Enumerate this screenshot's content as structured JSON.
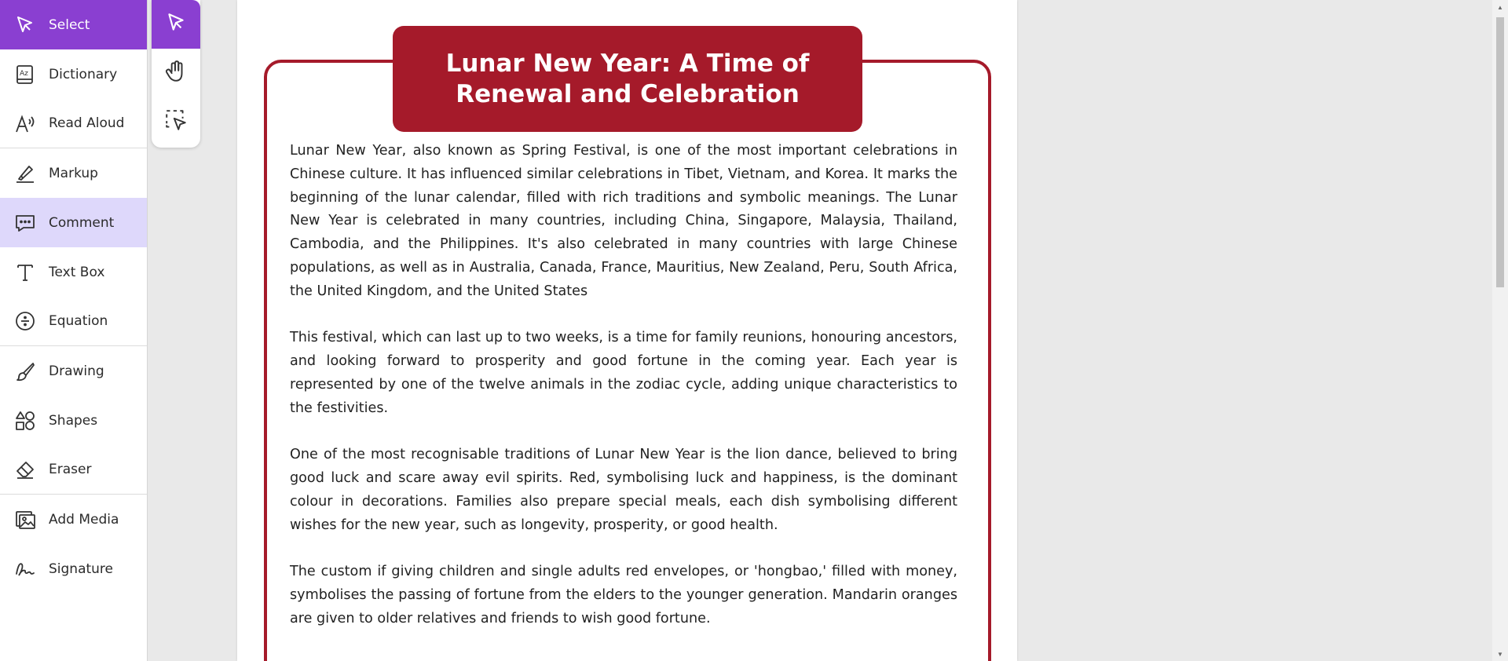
{
  "sidebar": {
    "items": [
      {
        "label": "Select",
        "icon": "pointer-icon"
      },
      {
        "label": "Dictionary",
        "icon": "dictionary-icon"
      },
      {
        "label": "Read Aloud",
        "icon": "read-aloud-icon"
      },
      {
        "label": "Markup",
        "icon": "highlighter-icon"
      },
      {
        "label": "Comment",
        "icon": "comment-icon"
      },
      {
        "label": "Text Box",
        "icon": "text-box-icon"
      },
      {
        "label": "Equation",
        "icon": "divide-icon"
      },
      {
        "label": "Drawing",
        "icon": "brush-icon"
      },
      {
        "label": "Shapes",
        "icon": "shapes-icon"
      },
      {
        "label": "Eraser",
        "icon": "eraser-icon"
      },
      {
        "label": "Add Media",
        "icon": "image-icon"
      },
      {
        "label": "Signature",
        "icon": "signature-icon"
      }
    ]
  },
  "submenu": {
    "items": [
      {
        "icon": "pointer-icon"
      },
      {
        "icon": "hand-icon"
      },
      {
        "icon": "selection-box-icon"
      }
    ]
  },
  "document": {
    "title": "Lunar New Year: A Time of Renewal and Celebration",
    "paragraphs": [
      "Lunar New Year, also known as Spring Festival, is one of the most important celebrations in Chinese culture. It has influenced similar celebrations in Tibet, Vietnam, and Korea. It marks the beginning of the lunar calendar, filled with rich traditions and symbolic meanings. The Lunar New Year is celebrated in many countries, including China, Singapore, Malaysia, Thailand, Cambodia, and the Philippines. It's also celebrated in many countries with large Chinese populations, as well as in Australia, Canada, France, Mauritius, New Zealand, Peru, South Africa, the United Kingdom, and the United States",
      "This festival, which can last up to two weeks, is a time for family reunions, honouring ancestors, and looking forward to prosperity and good fortune in the coming year. Each year is represented by one of the twelve animals in the zodiac cycle, adding unique characteristics to the festivities.",
      "One of the most recognisable traditions of Lunar New Year is the lion dance, believed to bring good luck and scare away evil spirits. Red, symbolising luck and happiness, is the dominant colour in decorations. Families also prepare special meals, each dish symbolising different wishes for the new year, such as longevity, prosperity, or good health.",
      "The custom if giving children and single adults red envelopes, or 'hongbao,' filled with money, symbolises the passing of fortune from the elders to the younger generation. Mandarin oranges are given to older relatives and friends to wish good fortune."
    ]
  },
  "colors": {
    "accent": "#8a3fd1",
    "highlight": "#ded8fb",
    "document_red": "#a51a2a"
  }
}
